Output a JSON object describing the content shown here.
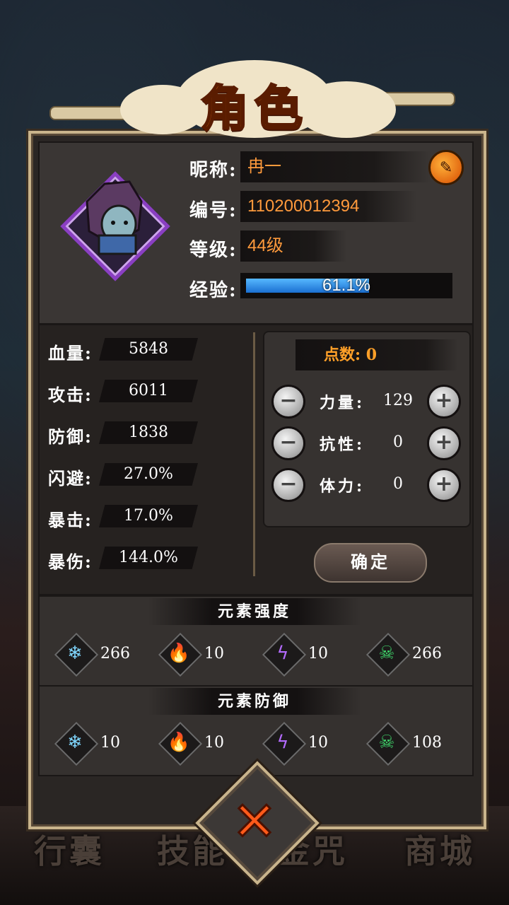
{
  "title": "角色",
  "profile": {
    "nickname_label": "昵称:",
    "nickname": "冉一",
    "id_label": "编号:",
    "id": "110200012394",
    "level_label": "等级:",
    "level": "44级",
    "exp_label": "经验:",
    "exp_text": "61.1%",
    "exp_fraction": 0.611
  },
  "stats": [
    {
      "label": "血量:",
      "value": "5848"
    },
    {
      "label": "攻击:",
      "value": "6011"
    },
    {
      "label": "防御:",
      "value": "1838"
    },
    {
      "label": "闪避:",
      "value": "27.0%"
    },
    {
      "label": "暴击:",
      "value": "17.0%"
    },
    {
      "label": "暴伤:",
      "value": "144.0%"
    }
  ],
  "points": {
    "label": "点数:",
    "value": "0",
    "attributes": [
      {
        "label": "力量:",
        "value": "129"
      },
      {
        "label": "抗性:",
        "value": "0"
      },
      {
        "label": "体力:",
        "value": "0"
      }
    ],
    "confirm_label": "确定"
  },
  "element_strength": {
    "title": "元素强度",
    "items": [
      {
        "icon": "ice-icon",
        "value": "266"
      },
      {
        "icon": "fire-icon",
        "value": "10"
      },
      {
        "icon": "lightning-icon",
        "value": "10"
      },
      {
        "icon": "poison-skull-icon",
        "value": "266"
      }
    ]
  },
  "element_defense": {
    "title": "元素防御",
    "items": [
      {
        "icon": "ice-icon",
        "value": "10"
      },
      {
        "icon": "fire-icon",
        "value": "10"
      },
      {
        "icon": "lightning-icon",
        "value": "10"
      },
      {
        "icon": "poison-skull-icon",
        "value": "108"
      }
    ]
  },
  "bottom_nav": [
    "行囊",
    "技能",
    "金咒",
    "商城"
  ],
  "colors": {
    "accent_orange": "#ff9a3c",
    "exp_blue": "#2a86e6",
    "frame_gold": "#c9b48c"
  }
}
